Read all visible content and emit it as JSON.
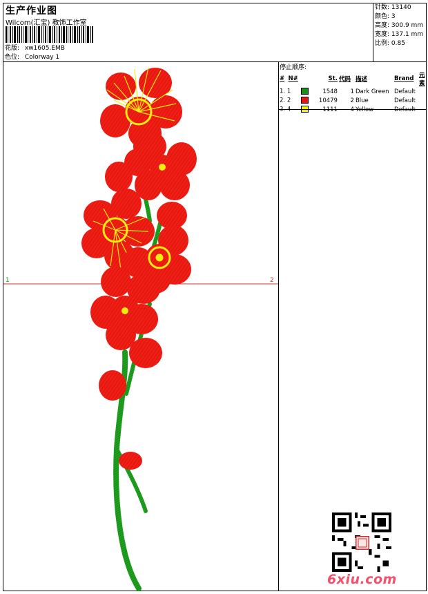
{
  "header": {
    "title": "生产作业图",
    "studio": "Wilcom(汇宝) 教饰工作室",
    "design_label": "花版:",
    "design_value": "xw1605.EMB",
    "colorway_label": "色位:",
    "colorway_value": "Colorway 1"
  },
  "stats": [
    {
      "label": "针数:",
      "value": "13140"
    },
    {
      "label": "颜色:",
      "value": "3"
    },
    {
      "label": "高度:",
      "value": "300.9 mm"
    },
    {
      "label": "宽度:",
      "value": "137.1 mm"
    },
    {
      "label": "比例:",
      "value": "0.85"
    }
  ],
  "design": {
    "marker_left": "1",
    "marker_right": "2"
  },
  "stop_sequence": {
    "title": "停止顺序:",
    "headers": [
      "#",
      "N#",
      "St.",
      "代码",
      "描述",
      "Brand",
      "元素"
    ],
    "rows": [
      {
        "idx": "1.",
        "n": "1",
        "color": "#1a8f1a",
        "st": "1548",
        "code": "1",
        "desc": "Dark Green",
        "brand": "Default"
      },
      {
        "idx": "2.",
        "n": "2",
        "color": "#ee1111",
        "st": "10479",
        "code": "2",
        "desc": "Blue",
        "brand": "Default"
      },
      {
        "idx": "3.",
        "n": "4",
        "color": "#f4ee00",
        "st": "1111",
        "code": "4",
        "desc": "Yellow",
        "brand": "Default"
      }
    ]
  },
  "watermark": "6xiu.com",
  "colors": {
    "green": "#1a9a1a",
    "red": "#ee1a14",
    "yellow": "#f2ec10",
    "marker_line": "#c0392b"
  }
}
